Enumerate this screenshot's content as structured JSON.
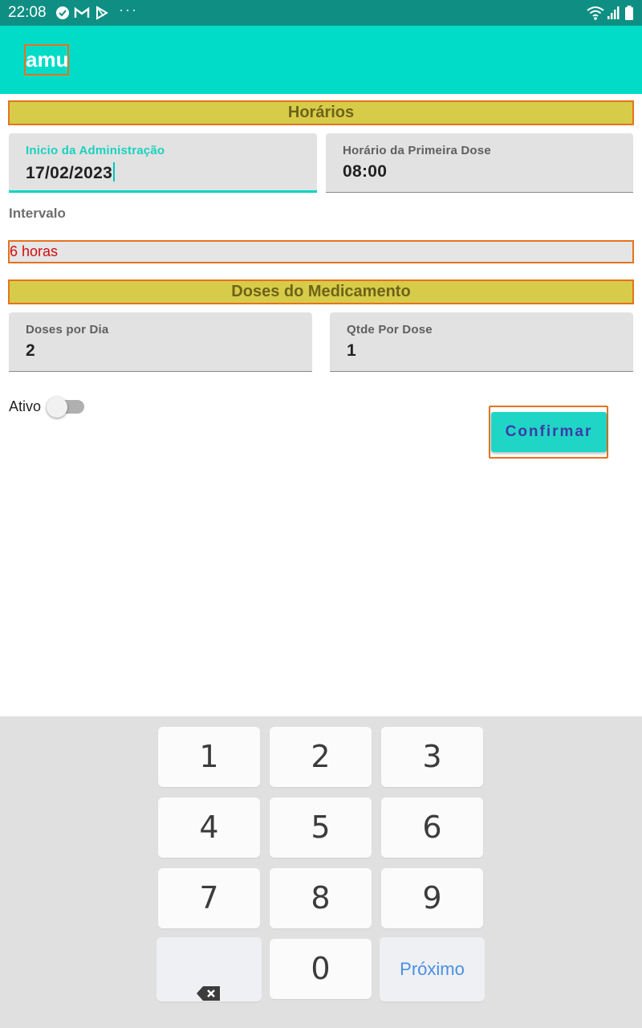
{
  "status_bar": {
    "time": "22:08",
    "dots": "···"
  },
  "app_bar": {
    "title": "amu"
  },
  "horarios_section": {
    "title": "Horários",
    "inicio_label": "Inicio da Administração",
    "inicio_value": "17/02/2023",
    "primeira_dose_label": "Horário da Primeira Dose",
    "primeira_dose_value": "08:00"
  },
  "intervalo": {
    "label": "Intervalo",
    "selected": "6 horas"
  },
  "doses_section": {
    "title": "Doses do Medicamento",
    "doses_dia_label": "Doses por Dia",
    "doses_dia_value": "2",
    "qtde_label": "Qtde Por Dose",
    "qtde_value": "1"
  },
  "ativo": {
    "label": "Ativo",
    "checked": false
  },
  "confirm_button": {
    "label": "Confirmar"
  },
  "keyboard": {
    "keys": [
      "1",
      "2",
      "3",
      "4",
      "5",
      "6",
      "7",
      "8",
      "9",
      "0"
    ],
    "next_label": "Próximo",
    "backspace_icon": "backspace-icon"
  },
  "colors": {
    "status_bar": "#0f8f84",
    "app_bar": "#00dcc8",
    "section_header": "#d6cc49",
    "accent": "#00d4c0",
    "error_text": "#d20d0d",
    "button_text": "#3e3ba8"
  }
}
